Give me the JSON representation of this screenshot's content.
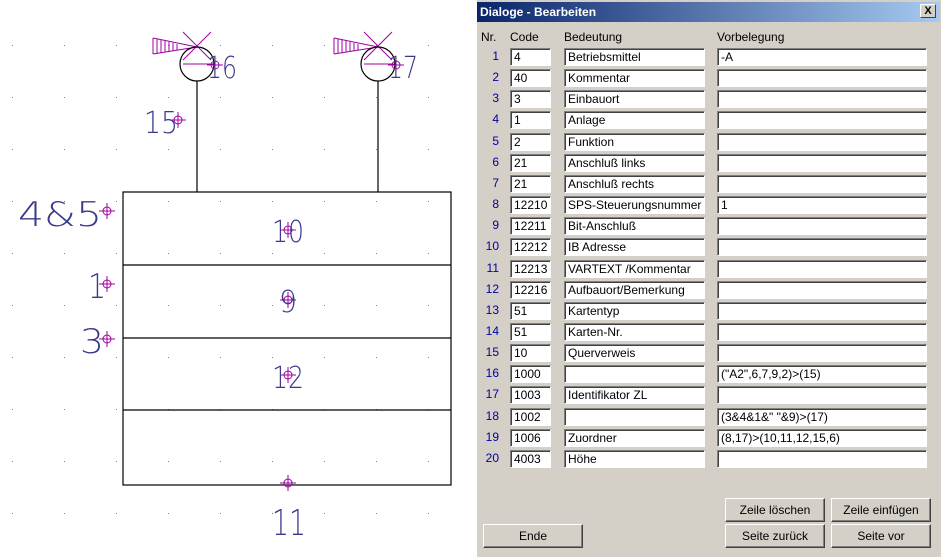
{
  "drawing": {
    "labels": {
      "l16": "16",
      "l17": "17",
      "l15": "15",
      "l4and5": "4&5",
      "l1": "1",
      "l3": "3",
      "l10": "10",
      "l9": "9",
      "l12": "12",
      "l11": "11"
    },
    "colors": {
      "marker": "#a000a0",
      "line": "#000000",
      "text": "#3a3a8c",
      "grid": "#808080"
    }
  },
  "dialog": {
    "title": "Dialoge - Bearbeiten",
    "close_label": "X",
    "headers": {
      "nr": "Nr.",
      "code": "Code",
      "bedeutung": "Bedeutung",
      "vorbelegung": "Vorbelegung"
    },
    "rows": [
      {
        "nr": "1",
        "code": "4",
        "bedeutung": "Betriebsmittel",
        "vorbelegung": "-A"
      },
      {
        "nr": "2",
        "code": "40",
        "bedeutung": "Kommentar",
        "vorbelegung": ""
      },
      {
        "nr": "3",
        "code": "3",
        "bedeutung": "Einbauort",
        "vorbelegung": ""
      },
      {
        "nr": "4",
        "code": "1",
        "bedeutung": "Anlage",
        "vorbelegung": ""
      },
      {
        "nr": "5",
        "code": "2",
        "bedeutung": "Funktion",
        "vorbelegung": ""
      },
      {
        "nr": "6",
        "code": "21",
        "bedeutung": "Anschluß links",
        "vorbelegung": ""
      },
      {
        "nr": "7",
        "code": "21",
        "bedeutung": "Anschluß rechts",
        "vorbelegung": ""
      },
      {
        "nr": "8",
        "code": "12210",
        "bedeutung": "SPS-Steuerungsnummer",
        "vorbelegung": "1"
      },
      {
        "nr": "9",
        "code": "12211",
        "bedeutung": "Bit-Anschluß",
        "vorbelegung": ""
      },
      {
        "nr": "10",
        "code": "12212",
        "bedeutung": "IB Adresse",
        "vorbelegung": ""
      },
      {
        "nr": "11",
        "code": "12213",
        "bedeutung": "VARTEXT  /Kommentar",
        "vorbelegung": ""
      },
      {
        "nr": "12",
        "code": "12216",
        "bedeutung": "Aufbauort/Bemerkung",
        "vorbelegung": ""
      },
      {
        "nr": "13",
        "code": "51",
        "bedeutung": "Kartentyp",
        "vorbelegung": ""
      },
      {
        "nr": "14",
        "code": "51",
        "bedeutung": "Karten-Nr.",
        "vorbelegung": ""
      },
      {
        "nr": "15",
        "code": "10",
        "bedeutung": "Querverweis",
        "vorbelegung": ""
      },
      {
        "nr": "16",
        "code": "1000",
        "bedeutung": "",
        "vorbelegung": "(\"A2\",6,7,9,2)>(15)"
      },
      {
        "nr": "17",
        "code": "1003",
        "bedeutung": "Identifikator ZL",
        "vorbelegung": ""
      },
      {
        "nr": "18",
        "code": "1002",
        "bedeutung": "",
        "vorbelegung": "(3&4&1&\" \"&9)>(17)"
      },
      {
        "nr": "19",
        "code": "1006",
        "bedeutung": "Zuordner",
        "vorbelegung": "(8,17)>(10,11,12,15,6)"
      },
      {
        "nr": "20",
        "code": "4003",
        "bedeutung": "Höhe",
        "vorbelegung": ""
      }
    ],
    "buttons": {
      "zeile_loeschen": "Zeile löschen",
      "zeile_einfuegen": "Zeile einfügen",
      "ende": "Ende",
      "seite_zurueck": "Seite zurück",
      "seite_vor": "Seite vor"
    }
  }
}
